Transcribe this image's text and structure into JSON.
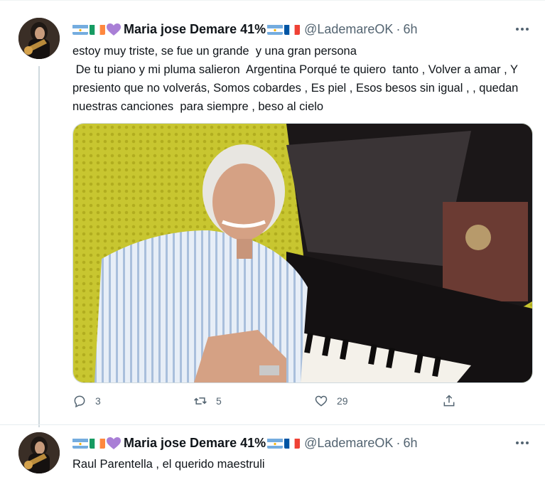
{
  "tweets": [
    {
      "display_name": "Maria jose Demare 41%",
      "handle": "@LademareOK",
      "separator": "·",
      "time": "6h",
      "text": "estoy muy triste, se fue un grande  y una gran persona\n De tu piano y mi pluma salieron  Argentina Porqué te quiero  tanto , Volver a amar , Y presiento que no volverás, Somos cobardes , Es piel , Esos besos sin igual , , quedan nuestras canciones  para siempre , beso al cielo",
      "image_alt": "Man with white hair smiling, seated at a grand piano",
      "actions": {
        "replies": "3",
        "retweets": "5",
        "likes": "29"
      },
      "icons": [
        "flag-argentina-icon",
        "flag-ireland-icon",
        "purple-heart-icon",
        "flag-argentina-icon",
        "flag-france-icon"
      ]
    },
    {
      "display_name": "Maria jose Demare 41%",
      "handle": "@LademareOK",
      "separator": "·",
      "time": "6h",
      "text": "Raul Parentella , el querido maestruli"
    }
  ],
  "colors": {
    "text": "#0f1419",
    "secondary": "#536471",
    "heart": "#a97fd6",
    "border": "#cfd9de"
  }
}
